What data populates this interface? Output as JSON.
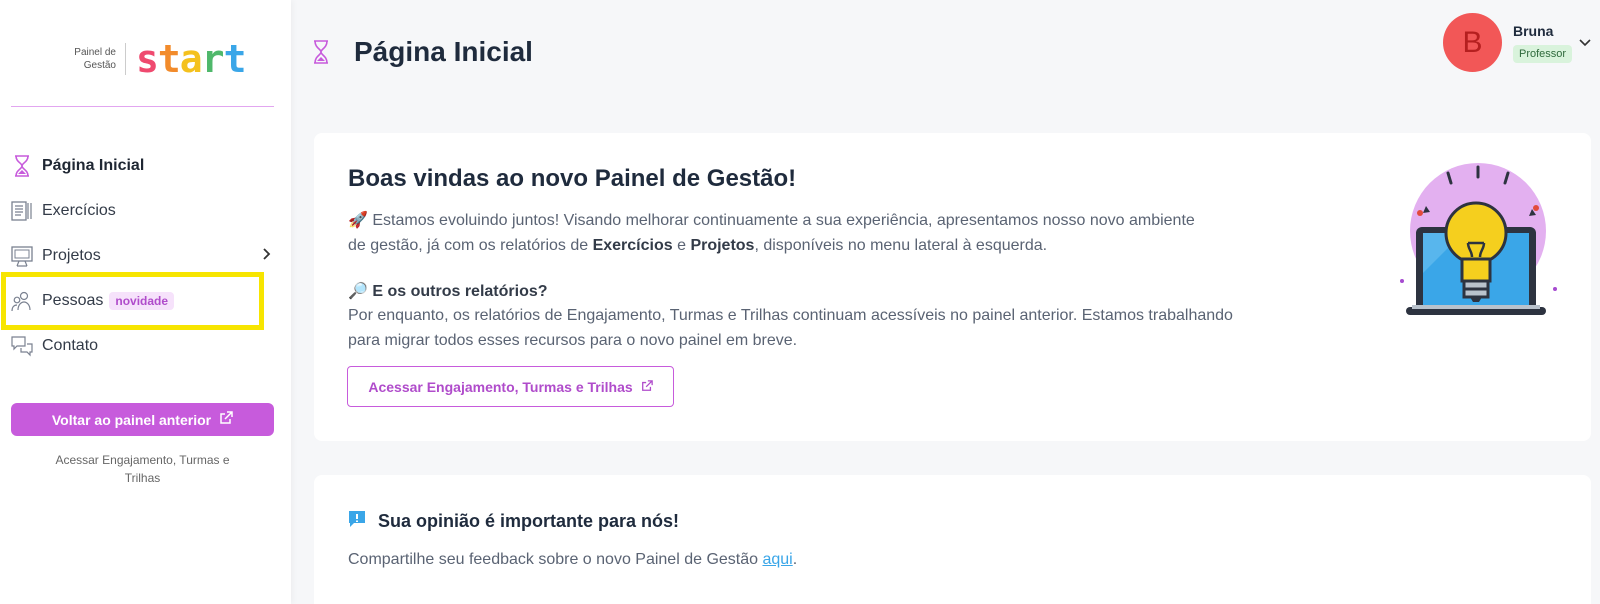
{
  "logo": {
    "small_line1": "Painel de",
    "small_line2": "Gestão",
    "brand": [
      "s",
      "t",
      "a",
      "r",
      "t"
    ]
  },
  "sidebar": {
    "items": [
      {
        "label": "Página Inicial",
        "icon": "hourglass-icon"
      },
      {
        "label": "Exercícios",
        "icon": "document-icon"
      },
      {
        "label": "Projetos",
        "icon": "monitor-icon"
      },
      {
        "label": "Pessoas",
        "icon": "people-icon",
        "badge": "novidade"
      },
      {
        "label": "Contato",
        "icon": "chat-icon"
      }
    ],
    "back_button": "Voltar ao painel anterior",
    "back_caption": "Acessar Engajamento, Turmas e Trilhas"
  },
  "header": {
    "title": "Página Inicial",
    "user": {
      "initial": "B",
      "name": "Bruna",
      "role": "Professor"
    }
  },
  "welcome": {
    "title": "Boas vindas ao novo Painel de Gestão!",
    "p1_a": "🚀 Estamos evoluindo juntos! Visando melhorar continuamente a sua experiência, apresentamos nosso novo ambiente de gestão, já com os relatórios de ",
    "p1_b": "Exercícios",
    "p1_c": " e ",
    "p1_d": "Projetos",
    "p1_e": ", disponíveis no menu lateral à esquerda.",
    "sub_title": "🔎 E os outros relatórios?",
    "p2": "Por enquanto, os relatórios de Engajamento, Turmas e Trilhas continuam acessíveis no painel anterior. Estamos trabalhando para migrar todos esses recursos para o novo painel em breve.",
    "button": "Acessar Engajamento, Turmas e Trilhas"
  },
  "feedback": {
    "title": "Sua opinião é importante para nós!",
    "text": "Compartilhe seu feedback sobre o novo Painel de Gestão ",
    "link": "aqui",
    "end": "."
  },
  "colors": {
    "accent": "#c75bdc",
    "highlight": "#f7e500",
    "avatar": "#f25757"
  }
}
